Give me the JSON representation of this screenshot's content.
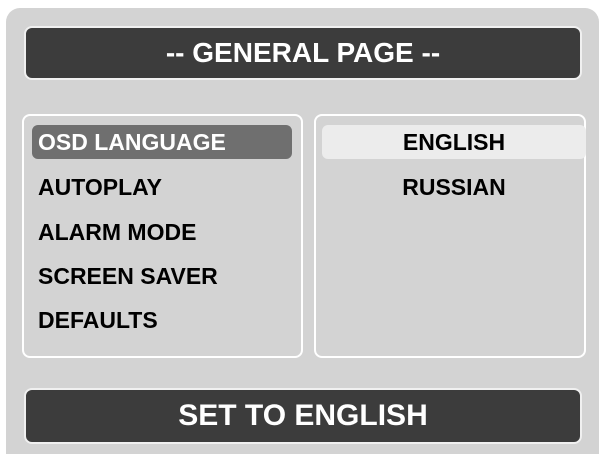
{
  "page": {
    "title": "-- GENERAL PAGE --",
    "status": "SET TO ENGLISH"
  },
  "menu": {
    "items": [
      {
        "label": "OSD LANGUAGE",
        "selected": true
      },
      {
        "label": "AUTOPLAY",
        "selected": false
      },
      {
        "label": "ALARM MODE",
        "selected": false
      },
      {
        "label": "SCREEN SAVER",
        "selected": false
      },
      {
        "label": "DEFAULTS",
        "selected": false
      }
    ]
  },
  "options": {
    "items": [
      {
        "label": "ENGLISH",
        "selected": true
      },
      {
        "label": "RUSSIAN",
        "selected": false
      }
    ]
  },
  "colors": {
    "background": "#d3d3d3",
    "bar": "#3c3c3c",
    "menu_highlight": "#6f6f6f",
    "option_highlight": "#ececec"
  }
}
